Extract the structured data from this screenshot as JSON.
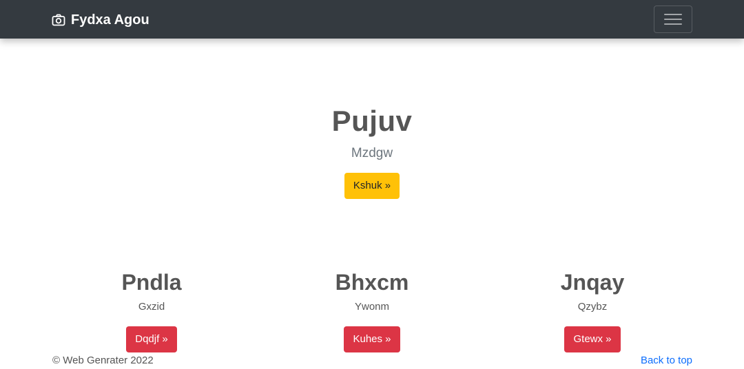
{
  "navbar": {
    "brand": "Fydxa Agou",
    "brand_icon": "camera-icon",
    "toggler_icon": "hamburger-menu-icon",
    "background": "#343a40"
  },
  "hero": {
    "title": "Pujuv",
    "subtitle": "Mzdgw",
    "button": "Kshuk »",
    "button_color": "#ffc107"
  },
  "columns": [
    {
      "title": "Pndla",
      "text": "Gxzid",
      "button": "Dqdjf »"
    },
    {
      "title": "Bhxcm",
      "text": "Ywonm",
      "button": "Kuhes »"
    },
    {
      "title": "Jnqay",
      "text": "Qzybz",
      "button": "Gtewx »"
    }
  ],
  "column_button_color": "#dc3545",
  "footer": {
    "copyright": "© Web Genrater 2022",
    "back_to_top": "Back to top"
  }
}
